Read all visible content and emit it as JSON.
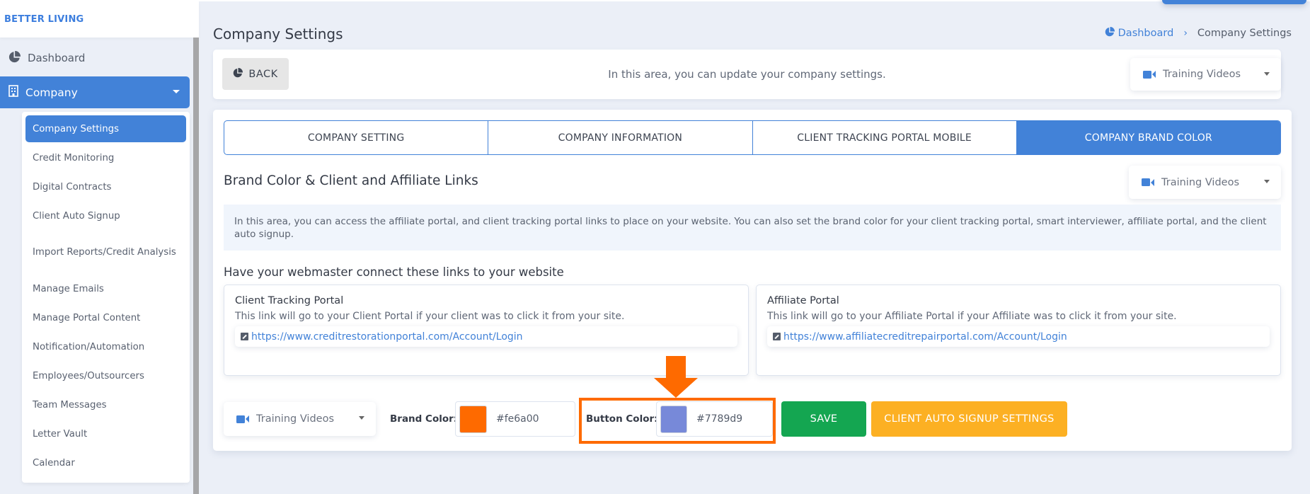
{
  "sidebar": {
    "brand": "BETTER LIVING",
    "dashboard": {
      "label": "Dashboard",
      "icon": "pie-chart-icon"
    },
    "company": {
      "label": "Company",
      "icon": "building-icon"
    },
    "submenu": [
      {
        "label": "Company Settings",
        "active": true
      },
      {
        "label": "Credit Monitoring"
      },
      {
        "label": "Digital Contracts"
      },
      {
        "label": "Client Auto Signup"
      },
      {
        "label": "Import Reports/Credit Analysis"
      },
      {
        "label": "Manage Emails"
      },
      {
        "label": "Manage Portal Content"
      },
      {
        "label": "Notification/Automation"
      },
      {
        "label": "Employees/Outsourcers"
      },
      {
        "label": "Team Messages"
      },
      {
        "label": "Letter Vault"
      },
      {
        "label": "Calendar"
      }
    ]
  },
  "header": {
    "title": "Company Settings",
    "breadcrumb": {
      "home": "Dashboard",
      "separator": "›",
      "current": "Company Settings"
    }
  },
  "top_card": {
    "back_label": "BACK",
    "description": "In this area, you can update your company settings.",
    "training_videos": "Training Videos"
  },
  "tabs": [
    {
      "label": "COMPANY SETTING"
    },
    {
      "label": "COMPANY INFORMATION"
    },
    {
      "label": "CLIENT TRACKING PORTAL MOBILE"
    },
    {
      "label": "COMPANY BRAND COLOR",
      "active": true
    }
  ],
  "brand_section": {
    "title": "Brand Color & Client and Affiliate Links",
    "training_videos": "Training Videos",
    "info": "In this area, you can access the affiliate portal, and client tracking portal links to place on your website. You can also set the brand color for your client tracking portal, smart interviewer, affiliate portal, and the client auto signup.",
    "webmaster_heading": "Have your webmaster connect these links to your website",
    "client_portal": {
      "title": "Client Tracking Portal",
      "description": "This link will go to your Client Portal if your client was to click it from your site.",
      "url": "https://www.creditrestorationportal.com/Account/Login"
    },
    "affiliate_portal": {
      "title": "Affiliate Portal",
      "description": "This link will go to your Affiliate Portal if your Affiliate was to click it from your site.",
      "url": "https://www.affiliatecreditrepairportal.com/Account/Login"
    }
  },
  "bottom_row": {
    "training_videos": "Training Videos",
    "brand_color_label": "Brand Color:",
    "brand_color_value": "#fe6a00",
    "button_color_label": "Button Color:",
    "button_color_value": "#7789d9",
    "save_label": "SAVE",
    "auto_signup_label": "CLIENT AUTO SIGNUP SETTINGS"
  },
  "colors": {
    "primary": "#4282d8",
    "brand_swatch": "#fe6a00",
    "button_swatch": "#7789d9",
    "save": "#14a651",
    "auto_signup": "#fcb023",
    "annotation": "#fe6a00"
  }
}
